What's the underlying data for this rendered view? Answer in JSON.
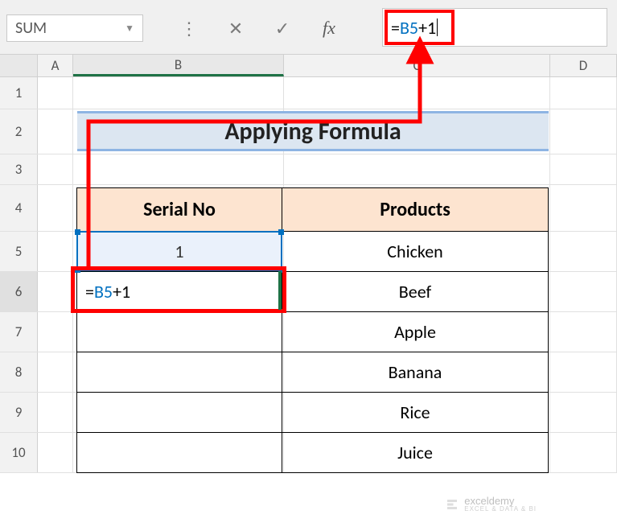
{
  "name_box": "SUM",
  "formula_bar": {
    "prefix": "=",
    "ref": "B5",
    "suffix": "+1"
  },
  "columns": {
    "a": "A",
    "b": "B",
    "c": "C",
    "d": "D"
  },
  "rows": [
    "1",
    "2",
    "3",
    "4",
    "5",
    "6",
    "7",
    "8",
    "9",
    "10"
  ],
  "title": "Applying Formula",
  "table": {
    "headers": {
      "serial": "Serial No",
      "products": "Products"
    },
    "rows": [
      {
        "serial": "1",
        "product": "Chicken"
      },
      {
        "serial_formula": {
          "prefix": "=",
          "ref": "B5",
          "suffix": "+1"
        },
        "product": "Beef"
      },
      {
        "serial": "",
        "product": "Apple"
      },
      {
        "serial": "",
        "product": "Banana"
      },
      {
        "serial": "",
        "product": "Rice"
      },
      {
        "serial": "",
        "product": "Juice"
      }
    ]
  },
  "watermark": {
    "brand": "exceldemy",
    "tagline": "EXCEL & DATA & BI"
  },
  "icons": {
    "cancel": "✕",
    "enter": "✓",
    "fx": "fx",
    "dropdown": "▼",
    "dots": "⋮"
  },
  "chart_data": {
    "type": "table",
    "title": "Applying Formula",
    "columns": [
      "Serial No",
      "Products"
    ],
    "rows": [
      [
        1,
        "Chicken"
      ],
      [
        "=B5+1",
        "Beef"
      ],
      [
        "",
        "Apple"
      ],
      [
        "",
        "Banana"
      ],
      [
        "",
        "Rice"
      ],
      [
        "",
        "Juice"
      ]
    ],
    "active_cell": "B6",
    "formula_bar": "=B5+1",
    "name_box": "SUM"
  }
}
